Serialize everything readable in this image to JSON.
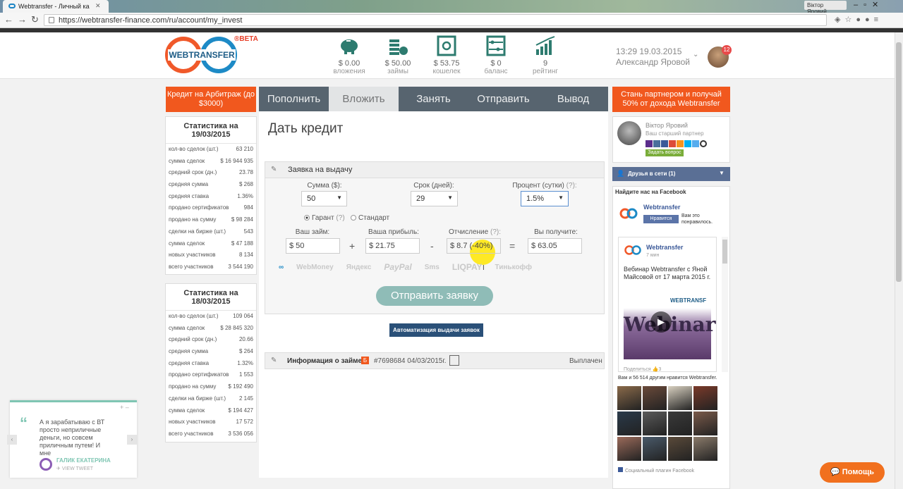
{
  "browser": {
    "tab_title": "Webtransfer - Личный ка",
    "url": "https://webtransfer-finance.com/ru/account/my_invest",
    "window_user": "Віктор Яровий"
  },
  "header": {
    "logo_text": "WEBTRANSFER",
    "beta": "®BETA",
    "stats": [
      {
        "value": "$ 0.00",
        "label": "вложения",
        "icon": "piggy-bank-icon"
      },
      {
        "value": "$ 50.00",
        "label": "займы",
        "icon": "coins-icon"
      },
      {
        "value": "$ 53.75",
        "label": "кошелек",
        "icon": "safe-icon"
      },
      {
        "value": "$ 0",
        "label": "баланс",
        "icon": "abacus-icon"
      },
      {
        "value": "9",
        "label": "рейтинг",
        "icon": "rating-chart-icon"
      }
    ],
    "datetime": "13:29 19.03.2015",
    "username": "Александр Яровой",
    "notifications": "12"
  },
  "left": {
    "promo": "Кредит на Арбитраж (до $3000)",
    "stats_today": {
      "title": "Статистика на 19/03/2015",
      "rows": [
        [
          "кол-во сделок (шт.)",
          "63 210"
        ],
        [
          "сумма сделок",
          "$ 16 944 935"
        ],
        [
          "средний срок (дн.)",
          "23.78"
        ],
        [
          "средняя сумма",
          "$ 268"
        ],
        [
          "средняя ставка",
          "1.36%"
        ],
        [
          "продано сертификатов",
          "984"
        ],
        [
          "продано на сумму",
          "$ 98 284"
        ],
        [
          "сделки на бирже (шт.)",
          "543"
        ],
        [
          "сумма сделок",
          "$ 47 188"
        ],
        [
          "новых участников",
          "8 134"
        ],
        [
          "всего участников",
          "3 544 190"
        ]
      ]
    },
    "stats_yesterday": {
      "title": "Статистика на 18/03/2015",
      "rows": [
        [
          "кол-во сделок (шт.)",
          "109 064"
        ],
        [
          "сумма сделок",
          "$ 28 845 320"
        ],
        [
          "средний срок (дн.)",
          "20.66"
        ],
        [
          "средняя сумма",
          "$ 264"
        ],
        [
          "средняя ставка",
          "1.32%"
        ],
        [
          "продано сертификатов",
          "1 553"
        ],
        [
          "продано на сумму",
          "$ 192 490"
        ],
        [
          "сделки на бирже (шт.)",
          "2 145"
        ],
        [
          "сумма сделок",
          "$ 194 427"
        ],
        [
          "новых участников",
          "17 572"
        ],
        [
          "всего участников",
          "3 536 056"
        ]
      ]
    }
  },
  "tabs": [
    "Пополнить",
    "Вложить",
    "Занять",
    "Отправить",
    "Вывод"
  ],
  "active_tab": "Вложить",
  "main": {
    "title": "Дать кредит",
    "form_header": "Заявка на выдачу",
    "amount_label": "Сумма ($):",
    "amount_value": "50",
    "term_label": "Срок (дней):",
    "term_value": "29",
    "rate_label": "Процент (сутки)",
    "rate_help": "(?):",
    "rate_value": "1.5%",
    "guarantee_label": "Гарант",
    "guarantee_help": "(?)",
    "standard_label": "Стандарт",
    "loan_label": "Ваш займ:",
    "loan_value": "$ 50",
    "profit_label": "Ваша прибыль:",
    "profit_value": "$ 21.75",
    "fee_label": "Отчисление",
    "fee_help": "(?):",
    "fee_value": "$ 8.7 (-40%)",
    "receive_label": "Вы получите:",
    "receive_value": "$ 63.05",
    "op_plus": "+",
    "op_minus": "-",
    "op_eq": "=",
    "payment_systems": [
      "WebMoney",
      "Яндекс",
      "PayPal",
      "Sms",
      "LIQPAY",
      "Тинькофф"
    ],
    "submit": "Отправить заявку",
    "auto_button": "Автоматизация выдачи заявок",
    "info_label": "Информация о займе",
    "info_number": "#7698684 04/03/2015г.",
    "info_status": "Выплачен"
  },
  "right": {
    "promo": "Стань партнером и получай 50% от дохода Webtransfer",
    "partner_name": "Віктор Яровий",
    "partner_role": "Ваш старший партнер",
    "ask_button": "Задать вопрос",
    "friends": "Друзья в сети (1)",
    "fb": {
      "header": "Найдите нас на Facebook",
      "page_name": "Webtransfer",
      "like_button": "Нравится",
      "liked_text": "Вам это понравилось.",
      "post_author": "Webtransfer",
      "post_time": "7 мин",
      "post_text": "Вебинар Webtransfer с Яной Майсовой от 17 марта 2015 г.",
      "video_text": "Webinar",
      "video_logo_text": "WEBTRANSF",
      "share": "Поделиться",
      "likes": "3",
      "count_text": "Вам и 56 514 другим нравится Webtransfer.",
      "plugin": "Социальный плагин Facebook"
    }
  },
  "tweet": {
    "text": "А я зарабатываю с ВТ просто неприличные деньги, но совсем приличным путем! И мне",
    "author": "ГАЛИК ЕКАТЕРИНА",
    "view": "VIEW TWEET"
  },
  "help_button": "Помощь",
  "colors": {
    "accent_orange": "#f1581e",
    "tab_bar": "#57646f",
    "icon_green": "#2d7b6f",
    "submit": "#8fbcb7"
  }
}
